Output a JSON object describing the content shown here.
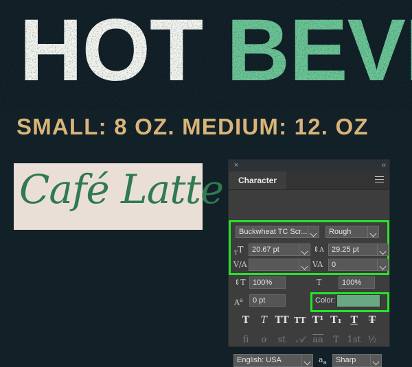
{
  "canvas": {
    "background_color": "#122028",
    "headline": {
      "word_white": "HOT",
      "word_green": "BEVERA",
      "white_color": "#f4f4ef",
      "green_color": "#6bc495"
    },
    "subhead": {
      "text": "SMALL: 8 OZ. MEDIUM: 12. OZ",
      "color": "#d9b478"
    },
    "artboard": {
      "background_color": "#eadfd6",
      "script_text": "Café Latte",
      "script_color": "#2f7a51"
    }
  },
  "panel": {
    "titlebar": {
      "close_icon": "×",
      "collapse_icon": "‹‹"
    },
    "tab_label": "Character",
    "menu_icon": "hamburger",
    "font": {
      "family_value": "Buckwheat TC Scr...",
      "style_value": "Rough"
    },
    "metrics": {
      "size_icon_label": "font-size",
      "size_value": "20.67 pt",
      "leading_icon_label": "leading",
      "leading_value": "29.25 pt",
      "kerning_icon_label": "kerning",
      "kerning_value": "",
      "tracking_icon_label": "tracking",
      "tracking_value": "0"
    },
    "scale": {
      "vertical_icon_label": "vertical-scale",
      "vertical_value": "100%",
      "horizontal_icon_label": "horizontal-scale",
      "horizontal_value": "100%",
      "baseline_icon_label": "baseline-shift",
      "baseline_value": "0 pt",
      "color_label": "Color:",
      "color_value": "#6aa882"
    },
    "style_buttons": [
      {
        "name": "faux-bold",
        "glyph": "T"
      },
      {
        "name": "faux-italic",
        "glyph": "T"
      },
      {
        "name": "all-caps",
        "glyph": "TT"
      },
      {
        "name": "small-caps",
        "glyph": "TT"
      },
      {
        "name": "superscript",
        "glyph": "T¹"
      },
      {
        "name": "subscript",
        "glyph": "T₁"
      },
      {
        "name": "underline",
        "glyph": "T"
      },
      {
        "name": "strikethrough",
        "glyph": "T"
      }
    ],
    "opentype_buttons": [
      {
        "name": "standard-ligatures",
        "glyph": "fi"
      },
      {
        "name": "contextual-alternates",
        "glyph": "o̵"
      },
      {
        "name": "discretionary-ligatures",
        "glyph": "st"
      },
      {
        "name": "swash",
        "glyph": "𝒜"
      },
      {
        "name": "stylistic-alternates",
        "glyph": "aa"
      },
      {
        "name": "titling-alternates",
        "glyph": "T"
      },
      {
        "name": "ordinals",
        "glyph": "1st"
      },
      {
        "name": "fractions",
        "glyph": "½"
      }
    ],
    "bottom": {
      "language_value": "English: USA",
      "antialias_icon_label": "aa",
      "antialias_value": "Sharp"
    },
    "annotation_color": "#27e327"
  }
}
